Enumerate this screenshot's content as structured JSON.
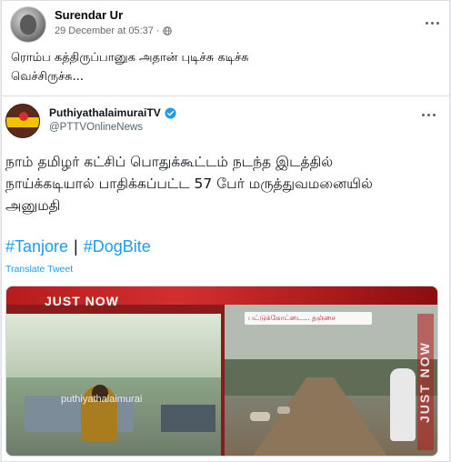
{
  "post": {
    "author": "Surendar Ur",
    "timestamp": "29 December at 05:37",
    "caption": "ரொம்ப கத்திருப்பானுக அதான் புடிச்சு கடிச்சு\nவெச்சிருச்சு..."
  },
  "tweet": {
    "name": "PuthiyathalaimuraiTV",
    "handle": "@PTTVOnlineNews",
    "text": "நாம் தமிழர் கட்சிப் பொதுக்கூட்டம் நடந்த இடத்தில்\nநாய்க்கடியால் பாதிக்கப்பட்ட 57 பேர் மருத்துவமனையில்\nஅனுமதி",
    "hashtags": [
      "#Tanjore",
      "#DogBite"
    ],
    "hashtag_separator": "|",
    "translate_label": "Translate Tweet"
  },
  "media": {
    "banner": "JUST NOW",
    "watermark": "puthiyathalaimurai",
    "news_tag": "பட்டுக்கோட்டை... தஞ்சை",
    "side_text": "JUST NOW"
  },
  "colors": {
    "link": "#1d9bf0",
    "banner_red": "#d32f2f",
    "meta_gray": "#65676b"
  },
  "icons": {
    "privacy": "globe-icon",
    "options": "more-horizontal-icon",
    "verified": "verified-badge-icon"
  }
}
